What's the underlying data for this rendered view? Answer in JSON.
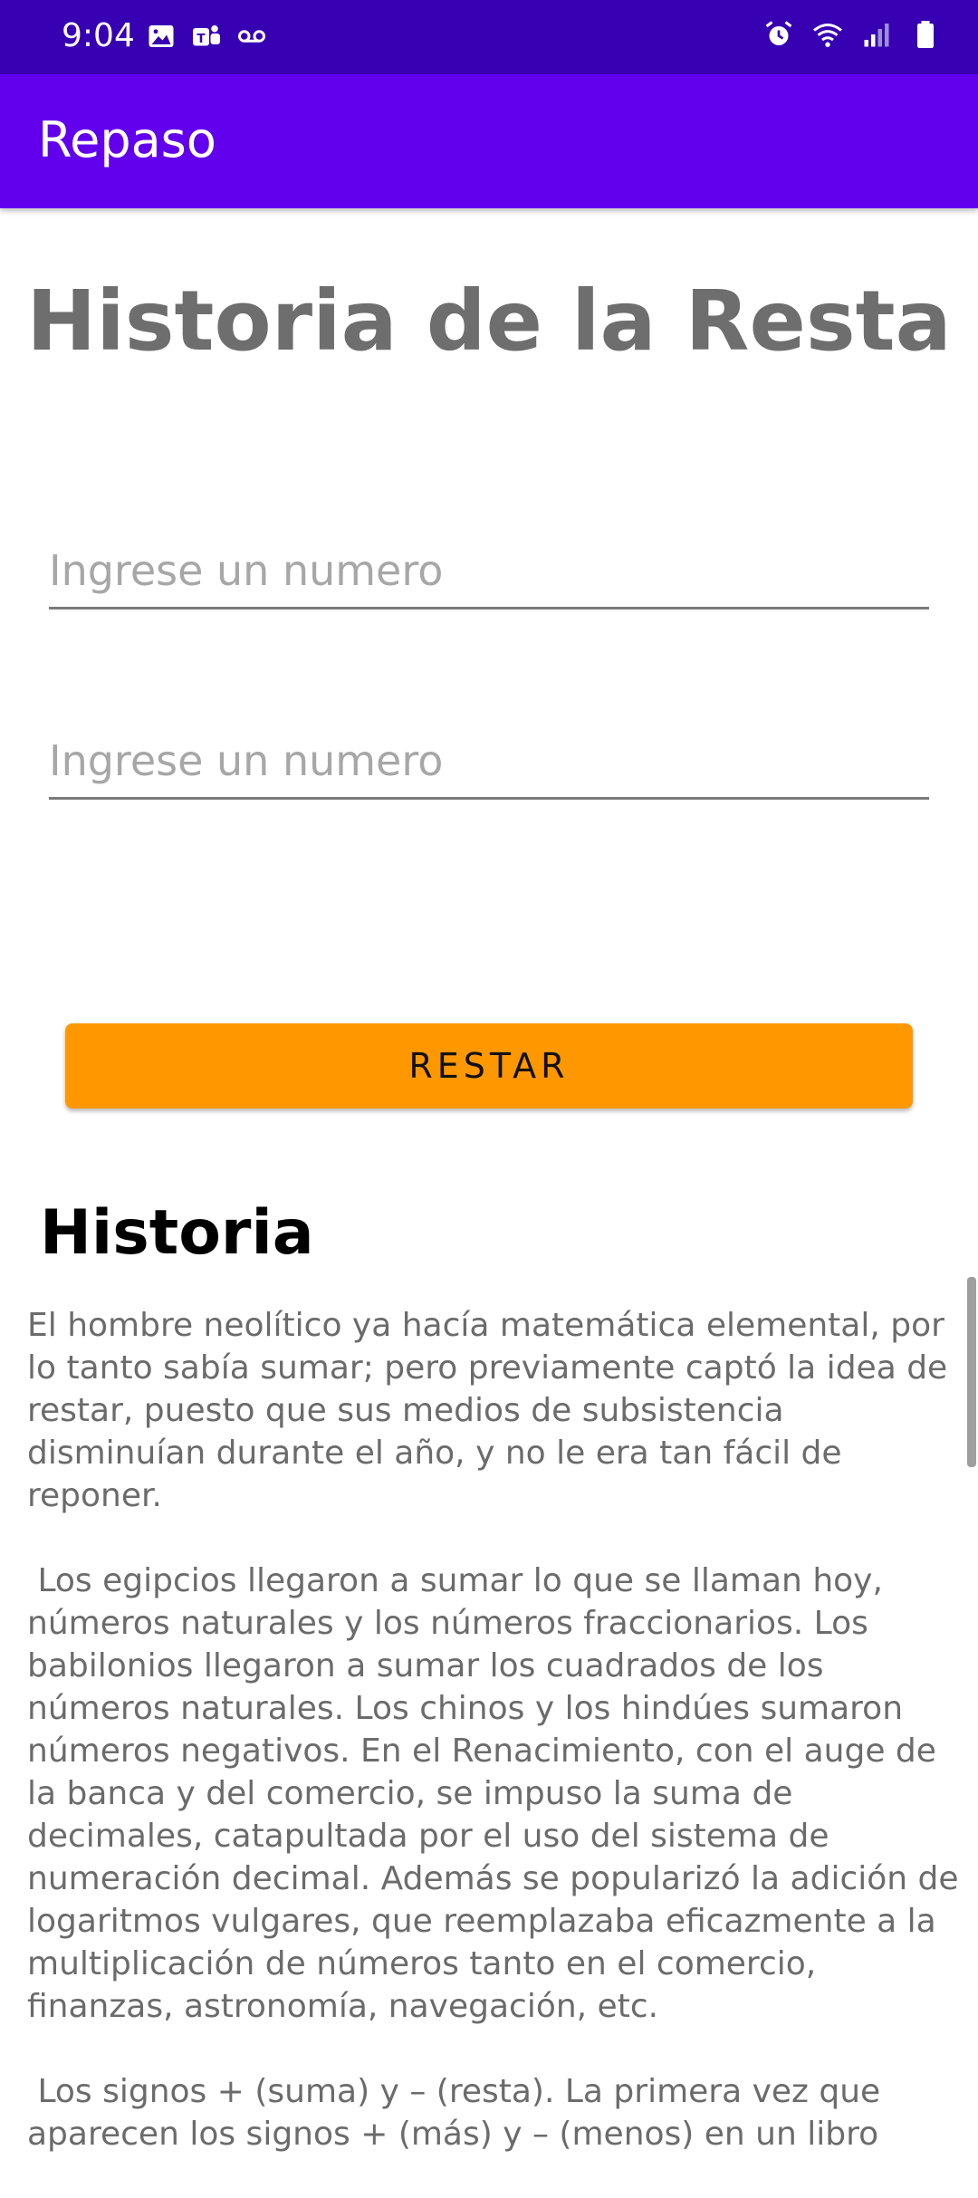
{
  "status_bar": {
    "time": "9:04",
    "left_icons": [
      "image-icon",
      "teams-icon",
      "voicemail-icon"
    ],
    "right_icons": [
      "alarm-icon",
      "wifi-icon",
      "signal-icon",
      "battery-icon"
    ]
  },
  "app_bar": {
    "title": "Repaso",
    "background": "#6200ee"
  },
  "main": {
    "title": "Historia de la Resta",
    "input1": {
      "placeholder": "Ingrese un numero",
      "value": ""
    },
    "input2": {
      "placeholder": "Ingrese un numero",
      "value": ""
    },
    "button_label": "RESTAR",
    "button_color": "#ff9800",
    "section_title": "Historia",
    "paragraphs": [
      "El hombre neolítico ya hacía matemática elemental, por lo tanto sabía sumar; pero previamente captó la idea de restar, puesto que sus medios de subsistencia disminuían durante el año, y no le era tan fácil de reponer.",
      " Los egipcios llegaron a sumar lo que se llaman hoy, números naturales y los números fraccionarios. Los babilonios llegaron a sumar los cuadrados de los números naturales. Los chinos y los hindúes sumaron números negativos. En el Renacimiento, con el auge de la banca y del comercio, se impuso la suma de decimales, catapultada por el uso del sistema de numeración decimal. Además se popularizó la adición de logaritmos vulgares, que reemplazaba eficazmente a la multiplicación de números tanto en el comercio, finanzas, astronomía, navegación, etc.",
      " Los signos + (suma) y – (resta). La primera vez que aparecen los signos + (más) y – (menos) en un libro"
    ]
  }
}
